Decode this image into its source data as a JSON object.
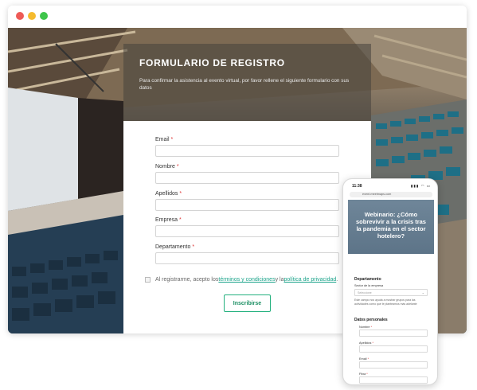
{
  "browser": {
    "window_controls": [
      "close",
      "minimize",
      "maximize"
    ]
  },
  "form": {
    "title": "FORMULARIO DE REGISTRO",
    "subtitle": "Para confirmar la asistencia al evento virtual, por favor rellene el siguiente formulario con sus datos",
    "fields": [
      {
        "label": "Email",
        "required_mark": "*"
      },
      {
        "label": "Nombre",
        "required_mark": "*"
      },
      {
        "label": "Apellidos",
        "required_mark": "*"
      },
      {
        "label": "Empresa",
        "required_mark": "*"
      },
      {
        "label": "Departamento",
        "required_mark": "*"
      }
    ],
    "consent": {
      "prefix": "Al registrarme, acepto los ",
      "terms_link": "términos y condiciones",
      "middle": " y la ",
      "privacy_link": "política de privacidad",
      "suffix": "."
    },
    "submit_label": "Inscribirse"
  },
  "phone": {
    "time": "11:38",
    "status_icons": "▮▮▮ ◠ ▭",
    "url": "event.meetmaps.com",
    "event_title": "Webinario: ¿Cómo sobrevivir a la crisis tras la pandemia en el sector hotelero?",
    "section_department": "Departamento",
    "sector_label": "Sector de la empresa",
    "sector_placeholder": "Seleccione",
    "sector_help": "Este campo nos ayuda a mostrar grupos para las actividades como que le planteamos más adelante",
    "section_personal": "Datos personales",
    "fields": [
      {
        "label": "Nombre",
        "required_mark": "*"
      },
      {
        "label": "Apellidos",
        "required_mark": "*"
      },
      {
        "label": "Email",
        "required_mark": "*"
      },
      {
        "label": "Fitxa",
        "required_mark": "*"
      }
    ]
  },
  "colors": {
    "accent_green": "#22b07d",
    "link_teal": "#1aa38a",
    "required_red": "#d33333",
    "close_dot": "#ee5b57",
    "minimize_dot": "#f5bb2e",
    "maximize_dot": "#3fc54b"
  }
}
